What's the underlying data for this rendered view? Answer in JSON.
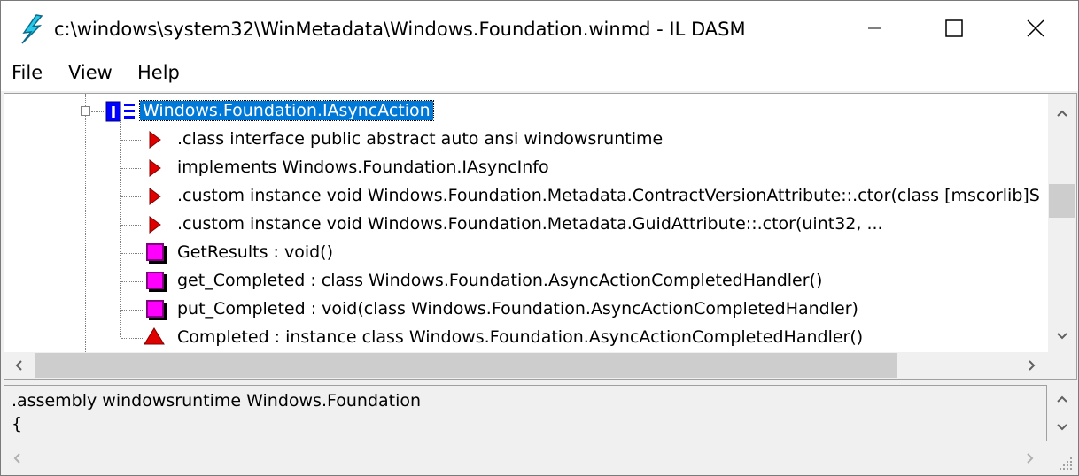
{
  "window": {
    "title": "c:\\windows\\system32\\WinMetadata\\Windows.Foundation.winmd - IL DASM",
    "app_icon": "ildasm-lightning-icon",
    "controls": {
      "minimize": "minimize-icon",
      "maximize": "maximize-icon",
      "close": "close-icon"
    }
  },
  "menu": {
    "items": [
      "File",
      "View",
      "Help"
    ]
  },
  "tree": {
    "root": {
      "label": "Windows.Foundation.IAsyncAction",
      "icon": "interface-icon",
      "selected": true,
      "expanded": true
    },
    "children": [
      {
        "label": ".class interface public abstract auto ansi windowsruntime",
        "icon": "class-info-icon"
      },
      {
        "label": " implements Windows.Foundation.IAsyncInfo",
        "icon": "class-info-icon"
      },
      {
        "label": ".custom instance void Windows.Foundation.Metadata.ContractVersionAttribute::.ctor(class [mscorlib]S",
        "icon": "class-info-icon"
      },
      {
        "label": ".custom instance void Windows.Foundation.Metadata.GuidAttribute::.ctor(uint32, ...",
        "icon": "class-info-icon"
      },
      {
        "label": "GetResults : void()",
        "icon": "method-icon"
      },
      {
        "label": "get_Completed : class Windows.Foundation.AsyncActionCompletedHandler()",
        "icon": "method-icon"
      },
      {
        "label": "put_Completed : void(class Windows.Foundation.AsyncActionCompletedHandler)",
        "icon": "method-icon"
      },
      {
        "label": "Completed : instance class Windows.Foundation.AsyncActionCompletedHandler()",
        "icon": "property-icon"
      }
    ]
  },
  "details": {
    "lines": [
      ".assembly windowsruntime Windows.Foundation",
      "{"
    ]
  },
  "colors": {
    "selection": "#0078d7",
    "method": "#ff00ff",
    "class_info": "#e00000",
    "property": "#e00000"
  }
}
